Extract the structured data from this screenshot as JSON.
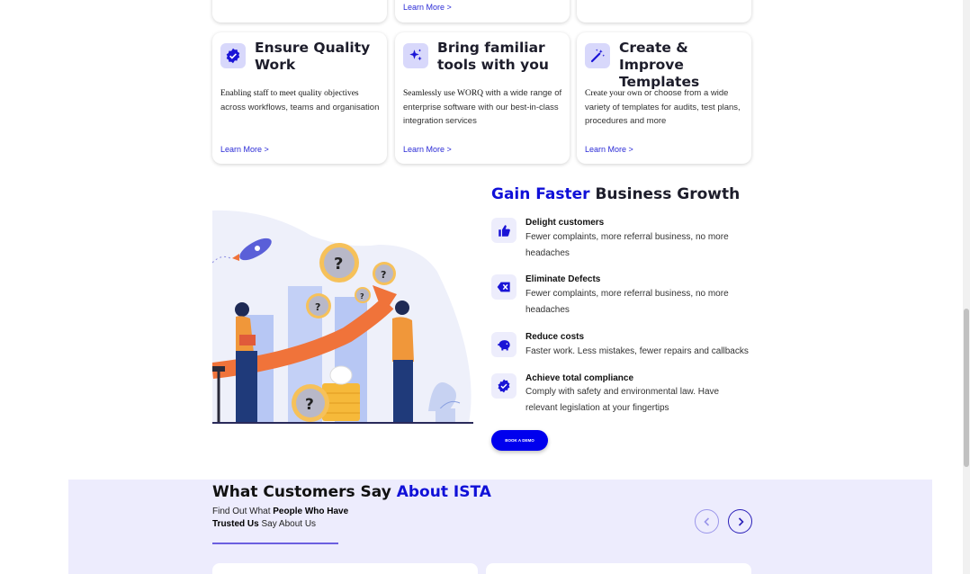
{
  "top_cards": {
    "middle_link": "Learn More >"
  },
  "cards": [
    {
      "title": "Ensure Quality Work",
      "desc_lead": "Enabling staff to meet quality objectives",
      "desc_rest": " across workflows, teams and organisation",
      "link": "Learn More >",
      "icon": "verified-badge-icon"
    },
    {
      "title": "Bring familiar tools with you",
      "desc_lead": "Seamlessly use WORQ",
      "desc_rest": " with a wide range of enterprise software with our best-in-class integration services",
      "link": "Learn More >",
      "icon": "sparkles-icon"
    },
    {
      "title": "Create & Improve Templates",
      "desc_lead": "Create your own",
      "desc_rest": " or choose from a wide variety of templates for audits, test plans, procedures and more",
      "link": "Learn More >",
      "icon": "magic-wand-icon"
    }
  ],
  "growth": {
    "title_accent": "Gain Faster",
    "title_rest": " Business Growth",
    "features": [
      {
        "title": "Delight customers",
        "desc": "Fewer complaints, more referral business, no more headaches",
        "icon": "thumbs-up-icon"
      },
      {
        "title": "Eliminate Defects",
        "desc": "Fewer complaints, more referral business, no more headaches",
        "icon": "backspace-x-icon"
      },
      {
        "title": "Reduce costs",
        "desc": "Faster work. Less mistakes, fewer repairs and callbacks",
        "icon": "piggy-bank-icon"
      },
      {
        "title": "Achieve total compliance",
        "desc": "Comply with safety and environmental law. Have relevant legislation at your fingertips",
        "icon": "verified-badge-icon"
      }
    ],
    "cta": "BOOK A DEMO"
  },
  "testimonials": {
    "title": "What Customers Say ",
    "title_accent": "About ISTA",
    "sub_a": "Find Out What ",
    "sub_b": "People Who Have Trusted Us",
    "sub_c": " Say About Us"
  },
  "colors": {
    "accent": "#1010d8",
    "icon_bg": "#d8d8fb",
    "testimonial_bg": "#edecfd",
    "illustration_orange": "#f0733a"
  }
}
